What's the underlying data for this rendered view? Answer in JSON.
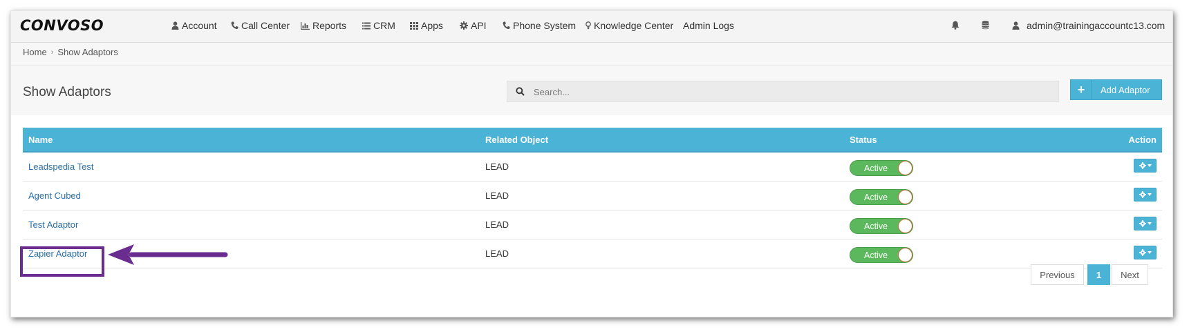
{
  "brand": {
    "logo": "CONVOSO"
  },
  "nav": {
    "items": [
      {
        "label": "Account",
        "icon": "user-icon"
      },
      {
        "label": "Call Center",
        "icon": "phone-icon"
      },
      {
        "label": "Reports",
        "icon": "bar-chart-icon"
      },
      {
        "label": "CRM",
        "icon": "list-icon"
      },
      {
        "label": "Apps",
        "icon": "grid-icon"
      },
      {
        "label": "API",
        "icon": "gear-icon"
      },
      {
        "label": "Phone System",
        "icon": "phone-icon"
      },
      {
        "label": "Knowledge Center",
        "icon": "lightbulb-icon"
      },
      {
        "label": "Admin Logs",
        "icon": ""
      }
    ],
    "user_email": "admin@trainingaccountc13.com"
  },
  "breadcrumb": {
    "home": "Home",
    "separator": "›",
    "current": "Show Adaptors"
  },
  "header": {
    "title": "Show Adaptors",
    "search_placeholder": "Search...",
    "add_button": "Add Adaptor",
    "add_button_icon": "+"
  },
  "table": {
    "columns": {
      "name": "Name",
      "related": "Related Object",
      "status": "Status",
      "action": "Action"
    },
    "rows": [
      {
        "name": "Leadspedia Test",
        "related": "LEAD",
        "status": "Active"
      },
      {
        "name": "Agent Cubed",
        "related": "LEAD",
        "status": "Active"
      },
      {
        "name": "Test Adaptor",
        "related": "LEAD",
        "status": "Active"
      },
      {
        "name": "Zapier Adaptor",
        "related": "LEAD",
        "status": "Active"
      }
    ]
  },
  "pagination": {
    "previous": "Previous",
    "current": "1",
    "next": "Next"
  },
  "colors": {
    "accent": "#4ab3d6",
    "active_toggle": "#5cb85c",
    "annotation": "#6a2c8e"
  }
}
